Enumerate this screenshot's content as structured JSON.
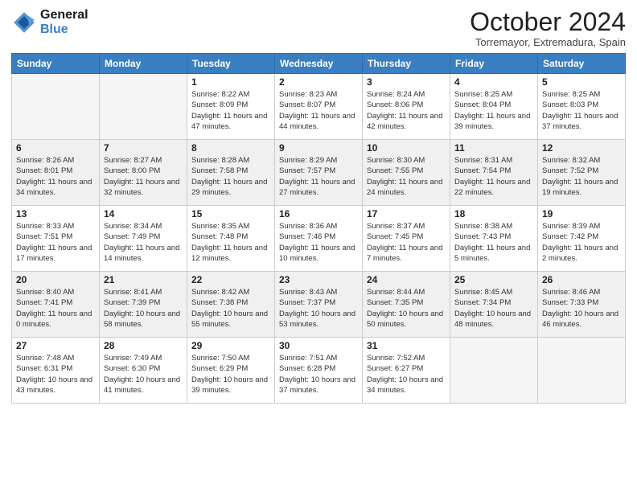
{
  "header": {
    "logo_general": "General",
    "logo_blue": "Blue",
    "month": "October 2024",
    "location": "Torremayor, Extremadura, Spain"
  },
  "weekdays": [
    "Sunday",
    "Monday",
    "Tuesday",
    "Wednesday",
    "Thursday",
    "Friday",
    "Saturday"
  ],
  "weeks": [
    [
      {
        "day": "",
        "sunrise": "",
        "sunset": "",
        "daylight": ""
      },
      {
        "day": "",
        "sunrise": "",
        "sunset": "",
        "daylight": ""
      },
      {
        "day": "1",
        "sunrise": "Sunrise: 8:22 AM",
        "sunset": "Sunset: 8:09 PM",
        "daylight": "Daylight: 11 hours and 47 minutes."
      },
      {
        "day": "2",
        "sunrise": "Sunrise: 8:23 AM",
        "sunset": "Sunset: 8:07 PM",
        "daylight": "Daylight: 11 hours and 44 minutes."
      },
      {
        "day": "3",
        "sunrise": "Sunrise: 8:24 AM",
        "sunset": "Sunset: 8:06 PM",
        "daylight": "Daylight: 11 hours and 42 minutes."
      },
      {
        "day": "4",
        "sunrise": "Sunrise: 8:25 AM",
        "sunset": "Sunset: 8:04 PM",
        "daylight": "Daylight: 11 hours and 39 minutes."
      },
      {
        "day": "5",
        "sunrise": "Sunrise: 8:25 AM",
        "sunset": "Sunset: 8:03 PM",
        "daylight": "Daylight: 11 hours and 37 minutes."
      }
    ],
    [
      {
        "day": "6",
        "sunrise": "Sunrise: 8:26 AM",
        "sunset": "Sunset: 8:01 PM",
        "daylight": "Daylight: 11 hours and 34 minutes."
      },
      {
        "day": "7",
        "sunrise": "Sunrise: 8:27 AM",
        "sunset": "Sunset: 8:00 PM",
        "daylight": "Daylight: 11 hours and 32 minutes."
      },
      {
        "day": "8",
        "sunrise": "Sunrise: 8:28 AM",
        "sunset": "Sunset: 7:58 PM",
        "daylight": "Daylight: 11 hours and 29 minutes."
      },
      {
        "day": "9",
        "sunrise": "Sunrise: 8:29 AM",
        "sunset": "Sunset: 7:57 PM",
        "daylight": "Daylight: 11 hours and 27 minutes."
      },
      {
        "day": "10",
        "sunrise": "Sunrise: 8:30 AM",
        "sunset": "Sunset: 7:55 PM",
        "daylight": "Daylight: 11 hours and 24 minutes."
      },
      {
        "day": "11",
        "sunrise": "Sunrise: 8:31 AM",
        "sunset": "Sunset: 7:54 PM",
        "daylight": "Daylight: 11 hours and 22 minutes."
      },
      {
        "day": "12",
        "sunrise": "Sunrise: 8:32 AM",
        "sunset": "Sunset: 7:52 PM",
        "daylight": "Daylight: 11 hours and 19 minutes."
      }
    ],
    [
      {
        "day": "13",
        "sunrise": "Sunrise: 8:33 AM",
        "sunset": "Sunset: 7:51 PM",
        "daylight": "Daylight: 11 hours and 17 minutes."
      },
      {
        "day": "14",
        "sunrise": "Sunrise: 8:34 AM",
        "sunset": "Sunset: 7:49 PM",
        "daylight": "Daylight: 11 hours and 14 minutes."
      },
      {
        "day": "15",
        "sunrise": "Sunrise: 8:35 AM",
        "sunset": "Sunset: 7:48 PM",
        "daylight": "Daylight: 11 hours and 12 minutes."
      },
      {
        "day": "16",
        "sunrise": "Sunrise: 8:36 AM",
        "sunset": "Sunset: 7:46 PM",
        "daylight": "Daylight: 11 hours and 10 minutes."
      },
      {
        "day": "17",
        "sunrise": "Sunrise: 8:37 AM",
        "sunset": "Sunset: 7:45 PM",
        "daylight": "Daylight: 11 hours and 7 minutes."
      },
      {
        "day": "18",
        "sunrise": "Sunrise: 8:38 AM",
        "sunset": "Sunset: 7:43 PM",
        "daylight": "Daylight: 11 hours and 5 minutes."
      },
      {
        "day": "19",
        "sunrise": "Sunrise: 8:39 AM",
        "sunset": "Sunset: 7:42 PM",
        "daylight": "Daylight: 11 hours and 2 minutes."
      }
    ],
    [
      {
        "day": "20",
        "sunrise": "Sunrise: 8:40 AM",
        "sunset": "Sunset: 7:41 PM",
        "daylight": "Daylight: 11 hours and 0 minutes."
      },
      {
        "day": "21",
        "sunrise": "Sunrise: 8:41 AM",
        "sunset": "Sunset: 7:39 PM",
        "daylight": "Daylight: 10 hours and 58 minutes."
      },
      {
        "day": "22",
        "sunrise": "Sunrise: 8:42 AM",
        "sunset": "Sunset: 7:38 PM",
        "daylight": "Daylight: 10 hours and 55 minutes."
      },
      {
        "day": "23",
        "sunrise": "Sunrise: 8:43 AM",
        "sunset": "Sunset: 7:37 PM",
        "daylight": "Daylight: 10 hours and 53 minutes."
      },
      {
        "day": "24",
        "sunrise": "Sunrise: 8:44 AM",
        "sunset": "Sunset: 7:35 PM",
        "daylight": "Daylight: 10 hours and 50 minutes."
      },
      {
        "day": "25",
        "sunrise": "Sunrise: 8:45 AM",
        "sunset": "Sunset: 7:34 PM",
        "daylight": "Daylight: 10 hours and 48 minutes."
      },
      {
        "day": "26",
        "sunrise": "Sunrise: 8:46 AM",
        "sunset": "Sunset: 7:33 PM",
        "daylight": "Daylight: 10 hours and 46 minutes."
      }
    ],
    [
      {
        "day": "27",
        "sunrise": "Sunrise: 7:48 AM",
        "sunset": "Sunset: 6:31 PM",
        "daylight": "Daylight: 10 hours and 43 minutes."
      },
      {
        "day": "28",
        "sunrise": "Sunrise: 7:49 AM",
        "sunset": "Sunset: 6:30 PM",
        "daylight": "Daylight: 10 hours and 41 minutes."
      },
      {
        "day": "29",
        "sunrise": "Sunrise: 7:50 AM",
        "sunset": "Sunset: 6:29 PM",
        "daylight": "Daylight: 10 hours and 39 minutes."
      },
      {
        "day": "30",
        "sunrise": "Sunrise: 7:51 AM",
        "sunset": "Sunset: 6:28 PM",
        "daylight": "Daylight: 10 hours and 37 minutes."
      },
      {
        "day": "31",
        "sunrise": "Sunrise: 7:52 AM",
        "sunset": "Sunset: 6:27 PM",
        "daylight": "Daylight: 10 hours and 34 minutes."
      },
      {
        "day": "",
        "sunrise": "",
        "sunset": "",
        "daylight": ""
      },
      {
        "day": "",
        "sunrise": "",
        "sunset": "",
        "daylight": ""
      }
    ]
  ]
}
